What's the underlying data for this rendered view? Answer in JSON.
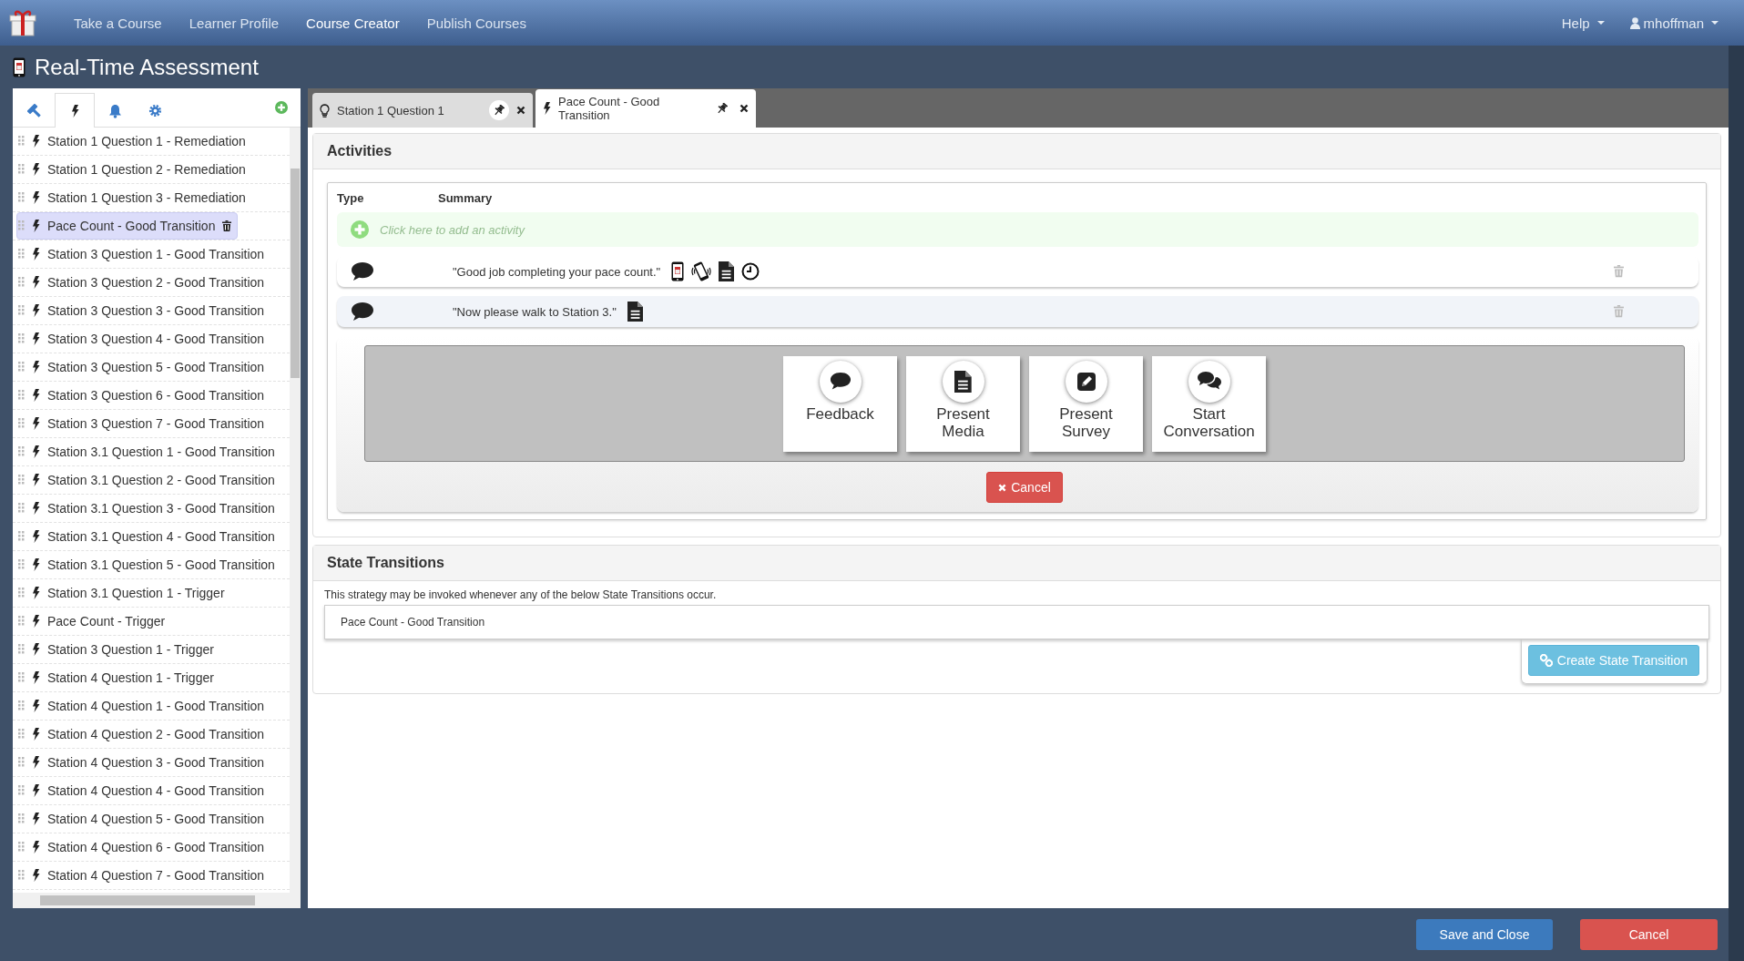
{
  "navbar": {
    "links": [
      {
        "label": "Take a Course",
        "selected": false
      },
      {
        "label": "Learner Profile",
        "selected": false
      },
      {
        "label": "Course Creator",
        "selected": true
      },
      {
        "label": "Publish Courses",
        "selected": false
      }
    ],
    "help": "Help",
    "user": "mhoffman"
  },
  "dialog": {
    "title": "Real-Time Assessment"
  },
  "sidebar": {
    "tabs": [
      {
        "kind": "hammer",
        "selected": false
      },
      {
        "kind": "bolt",
        "selected": true
      },
      {
        "kind": "bell",
        "selected": false
      },
      {
        "kind": "gear",
        "selected": false
      }
    ],
    "items": [
      {
        "label": "Station 1 Question 1 - Remediation",
        "selected": false
      },
      {
        "label": "Station 1 Question 2 - Remediation",
        "selected": false
      },
      {
        "label": "Station 1 Question 3 - Remediation",
        "selected": false
      },
      {
        "label": "Pace Count - Good Transition",
        "selected": true
      },
      {
        "label": "Station 3 Question 1 - Good Transition",
        "selected": false
      },
      {
        "label": "Station 3 Question 2 - Good Transition",
        "selected": false
      },
      {
        "label": "Station 3 Question 3 - Good Transition",
        "selected": false
      },
      {
        "label": "Station 3 Question 4 - Good Transition",
        "selected": false
      },
      {
        "label": "Station 3 Question 5 - Good Transition",
        "selected": false
      },
      {
        "label": "Station 3 Question 6 - Good Transition",
        "selected": false
      },
      {
        "label": "Station 3 Question 7 - Good Transition",
        "selected": false
      },
      {
        "label": "Station 3.1 Question 1 - Good Transition",
        "selected": false
      },
      {
        "label": "Station 3.1 Question 2 - Good Transition",
        "selected": false
      },
      {
        "label": "Station 3.1 Question 3 - Good Transition",
        "selected": false
      },
      {
        "label": "Station 3.1 Question 4 - Good Transition",
        "selected": false
      },
      {
        "label": "Station 3.1 Question 5 - Good Transition",
        "selected": false
      },
      {
        "label": "Station 3.1 Question 1 - Trigger",
        "selected": false
      },
      {
        "label": "Pace Count - Trigger",
        "selected": false
      },
      {
        "label": "Station 3 Question 1 - Trigger",
        "selected": false
      },
      {
        "label": "Station 4 Question 1 - Trigger",
        "selected": false
      },
      {
        "label": "Station 4 Question 1 - Good Transition",
        "selected": false
      },
      {
        "label": "Station 4 Question 2 - Good Transition",
        "selected": false
      },
      {
        "label": "Station 4 Question 3 - Good Transition",
        "selected": false
      },
      {
        "label": "Station 4 Question 4 - Good Transition",
        "selected": false
      },
      {
        "label": "Station 4 Question 5 - Good Transition",
        "selected": false
      },
      {
        "label": "Station 4 Question 6 - Good Transition",
        "selected": false
      },
      {
        "label": "Station 4 Question 7 - Good Transition",
        "selected": false
      }
    ]
  },
  "editor_tabs": [
    {
      "kind": "bulb",
      "label": "Station 1 Question 1",
      "selected": false
    },
    {
      "kind": "bolt",
      "label": "Pace Count - Good Transition",
      "selected": true
    }
  ],
  "activities": {
    "title": "Activities",
    "columns": [
      "Type",
      "Summary"
    ],
    "add_prompt": "Click here to add an activity",
    "rows": [
      {
        "kind": "feedback",
        "summary": "\"Good job completing your pace count.\"",
        "selected": false,
        "attachments": [
          {
            "kind": "mobile"
          },
          {
            "kind": "vibrate"
          },
          {
            "kind": "document"
          },
          {
            "kind": "clock"
          }
        ]
      },
      {
        "kind": "feedback",
        "summary": "\"Now please walk to Station 3.\"",
        "selected": true,
        "attachments": [
          {
            "kind": "document"
          }
        ]
      }
    ],
    "choices": [
      {
        "kind": "feedback",
        "label": "Feedback"
      },
      {
        "kind": "media",
        "label": "Present Media"
      },
      {
        "kind": "survey",
        "label": "Present Survey"
      },
      {
        "kind": "conversation",
        "label": "Start Conversation"
      }
    ],
    "cancel": "Cancel"
  },
  "state_transitions": {
    "title": "State Transitions",
    "description": "This strategy may be invoked whenever any of the below State Transitions occur.",
    "items": [
      "Pace Count - Good Transition"
    ],
    "create_button": "Create State Transition"
  },
  "footer": {
    "buttons": [
      {
        "kind": "primary",
        "label": "Save and Close"
      },
      {
        "kind": "danger",
        "label": "Cancel"
      }
    ]
  }
}
